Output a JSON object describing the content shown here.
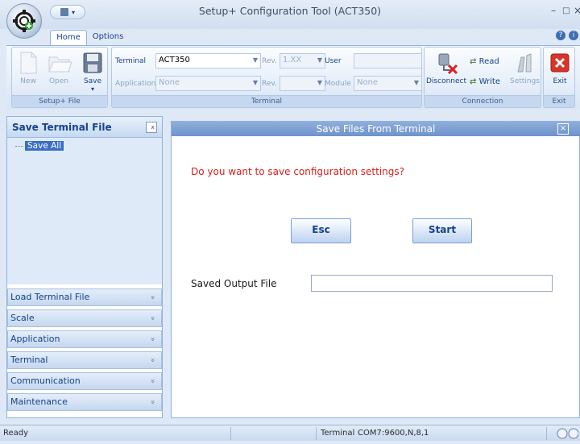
{
  "window": {
    "title": "Setup+ Configuration Tool (ACT350)",
    "controls": [
      "–",
      "□",
      "×"
    ]
  },
  "ribbon_tabs": [
    {
      "label": "Home",
      "active": true
    },
    {
      "label": "Options",
      "active": false
    }
  ],
  "setup_file_group": {
    "label": "Setup+ File",
    "buttons": [
      {
        "label": "New",
        "enabled": false,
        "icon": "new-file-icon"
      },
      {
        "label": "Open",
        "enabled": false,
        "icon": "open-folder-icon"
      },
      {
        "label": "Save",
        "enabled": true,
        "icon": "save-disk-icon",
        "dropdown": "▾"
      }
    ]
  },
  "terminal_group": {
    "label": "Terminal",
    "terminal_label": "Terminal",
    "terminal_value": "ACT350",
    "rev1_label": "Rev.",
    "rev1_value": "1.XX",
    "user_label": "User",
    "user_value": "",
    "application_label": "Application",
    "application_value": "None",
    "rev2_label": "Rev.",
    "rev2_value": "",
    "module_label": "Module",
    "module_value": "None"
  },
  "connection_group": {
    "label": "Connection",
    "disconnect_label": "Disconnect",
    "read_label": "Read",
    "write_label": "Write",
    "settings_label": "Settings"
  },
  "exit_group": {
    "label": "Exit",
    "exit_label": "Exit"
  },
  "left_panel": {
    "title": "Save Terminal File",
    "collapse_glyph": "«",
    "tree_items": [
      "Save All"
    ],
    "nav_sections": [
      "Load Terminal File",
      "Scale",
      "Application",
      "Terminal",
      "Communication",
      "Maintenance"
    ],
    "chevron": "»"
  },
  "dialog": {
    "title": "Save Files From Terminal",
    "question": "Do you want to save configuration settings?",
    "esc_label": "Esc",
    "start_label": "Start",
    "output_label": "Saved Output File",
    "output_value": ""
  },
  "status_bar": {
    "status": "Ready",
    "terminal_label": "Terminal",
    "port_settings": "COM7:9600,N,8,1"
  },
  "colors": {
    "accent": "#15428b",
    "question_text": "#d8201c",
    "dialog_title": "#7d9fd3",
    "exit_red": "#d9342b"
  }
}
